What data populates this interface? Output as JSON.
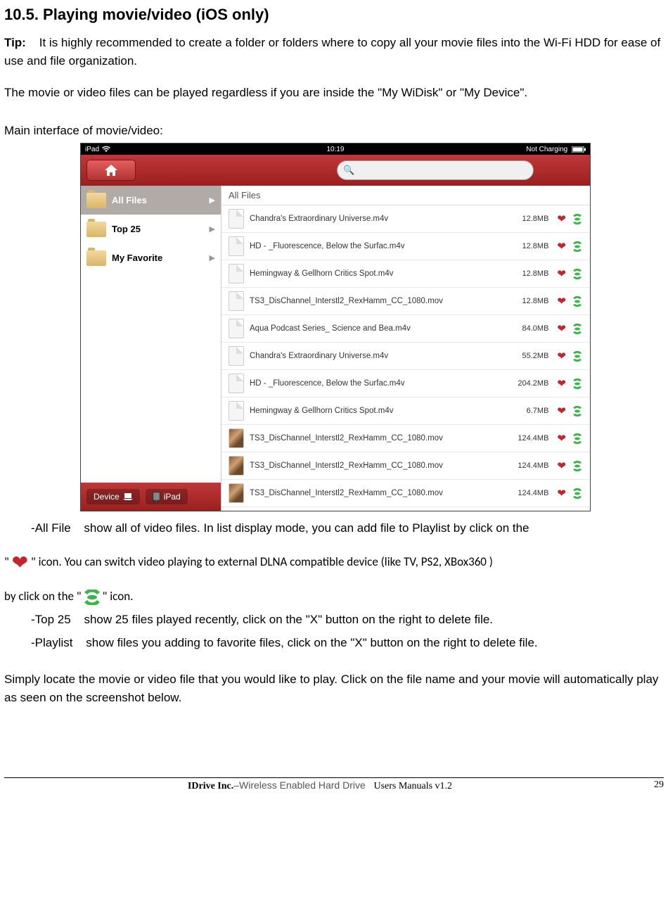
{
  "heading": "10.5. Playing movie/video (iOS only)",
  "tip_label": "Tip:",
  "tip_text": "It is highly recommended to create a folder or folders where to copy all your movie files into the Wi-Fi HDD for ease of use and file organization.",
  "para_note": "The movie or video files can be played regardless if you are inside the \"My WiDisk\" or \"My Device\".",
  "para_interface": "Main interface of movie/video:",
  "status_bar": {
    "carrier": "iPad",
    "time": "10:19",
    "battery": "Not Charging"
  },
  "search_icon_symbol": "🔍",
  "sidebar": {
    "items": [
      {
        "label": "All Files",
        "active": true
      },
      {
        "label": "Top 25",
        "active": false
      },
      {
        "label": "My Favorite",
        "active": false
      }
    ],
    "bottom_device": "Device",
    "bottom_ipad": "iPad"
  },
  "content_header": "All Files",
  "files": [
    {
      "name": "Chandra's Extraordinary Universe.m4v",
      "size": "12.8MB",
      "thumb": false
    },
    {
      "name": "HD - _Fluorescence, Below the Surfac.m4v",
      "size": "12.8MB",
      "thumb": false
    },
    {
      "name": "Hemingway & Gellhorn Critics Spot.m4v",
      "size": "12.8MB",
      "thumb": false
    },
    {
      "name": "TS3_DisChannel_Interstl2_RexHamm_CC_1080.mov",
      "size": "12.8MB",
      "thumb": false
    },
    {
      "name": "Aqua Podcast Series_ Science and Bea.m4v",
      "size": "84.0MB",
      "thumb": false
    },
    {
      "name": "Chandra's Extraordinary Universe.m4v",
      "size": "55.2MB",
      "thumb": false
    },
    {
      "name": "HD - _Fluorescence, Below the Surfac.m4v",
      "size": "204.2MB",
      "thumb": false
    },
    {
      "name": "Hemingway & Gellhorn Critics Spot.m4v",
      "size": "6.7MB",
      "thumb": false
    },
    {
      "name": "TS3_DisChannel_Interstl2_RexHamm_CC_1080.mov",
      "size": "124.4MB",
      "thumb": true
    },
    {
      "name": "TS3_DisChannel_Interstl2_RexHamm_CC_1080.mov",
      "size": "124.4MB",
      "thumb": true
    },
    {
      "name": "TS3_DisChannel_Interstl2_RexHamm_CC_1080.mov",
      "size": "124.4MB",
      "thumb": true
    }
  ],
  "desc": {
    "allfile_label": "-All File",
    "allfile_text1": "show all of video files. In list display mode, you can add file to Playlist by click on the",
    "allfile_text2_prefix": "\"",
    "allfile_text2_mid": "\" icon. You can switch video playing to external DLNA compatible device (like TV, PS2, XBox360 )",
    "allfile_text3_prefix": "by click on the \"",
    "allfile_text3_suffix": "\" icon.",
    "top25_label": "-Top 25",
    "top25_text": "show 25 files played recently, click on the \"X\" button on the right to delete file.",
    "playlist_label": "-Playlist",
    "playlist_text": "show files you adding to favorite files, click on the \"X\" button on the right to delete file."
  },
  "para_locate": "Simply locate the movie or video file that you would like to play.    Click on the file name and your movie will automatically play as seen on the screenshot below.",
  "footer": {
    "company": "IDrive Inc.",
    "product": "–Wireless Enabled Hard Drive",
    "manual": "Users Manuals v1.2",
    "page": "29"
  }
}
